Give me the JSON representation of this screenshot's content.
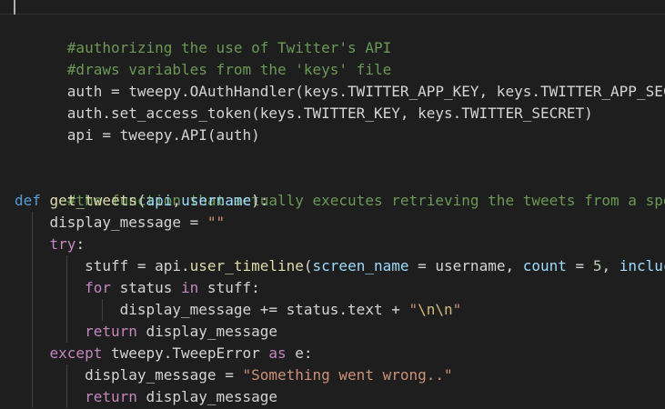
{
  "code": {
    "line_1": "#authorizing the use of Twitter's API",
    "line_2": "#draws variables from the 'keys' file",
    "line_3": "auth = tweepy.OAuthHandler(keys.TWITTER_APP_KEY, keys.TWITTER_APP_SECRET)",
    "line_4": "auth.set_access_token(keys.TWITTER_KEY, keys.TWITTER_SECRET)",
    "line_5": "api = tweepy.API(auth)",
    "line_8": "#the function that actually executes retrieving the tweets from a specified",
    "line_9": {
      "kw_def": "def",
      "fn_name": "get_tweets",
      "open": "(",
      "p1": "api",
      "comma": ",",
      "p2": "username",
      "close": "):"
    },
    "line_10": {
      "text": "display_message = ",
      "str": "\"\""
    },
    "line_11": {
      "kw": "try",
      "rest": ":"
    },
    "line_12": {
      "a": "stuff = api.",
      "fn": "user_timeline",
      "b": "(",
      "p1": "screen_name",
      "c": " = username, ",
      "p2": "count",
      "d": " = ",
      "num": "5",
      "e": ", ",
      "p3": "incluc"
    },
    "line_13": {
      "kw_for": "for",
      "a": " status ",
      "kw_in": "in",
      "b": " stuff:"
    },
    "line_14": {
      "a": "display_message += status.text + ",
      "q1": "\"",
      "esc": "\\n\\n",
      "q2": "\""
    },
    "line_15": {
      "kw": "return",
      "rest": " display_message"
    },
    "line_16": {
      "kw_except": "except",
      "a": " tweepy.TweepError ",
      "kw_as": "as",
      "b": " e:"
    },
    "line_17": {
      "a": "display_message = ",
      "str": "\"Something went wrong..\""
    },
    "line_18": {
      "kw": "return",
      "rest": " display_message"
    }
  },
  "colors": {
    "background": "#1e1e1e",
    "comment": "#6a9955",
    "keyword": "#569cd6",
    "control": "#c586c0",
    "function": "#dcdcaa",
    "parameter": "#9cdcfe",
    "string": "#ce9178",
    "number": "#b5cea8",
    "text": "#d4d4d4"
  }
}
